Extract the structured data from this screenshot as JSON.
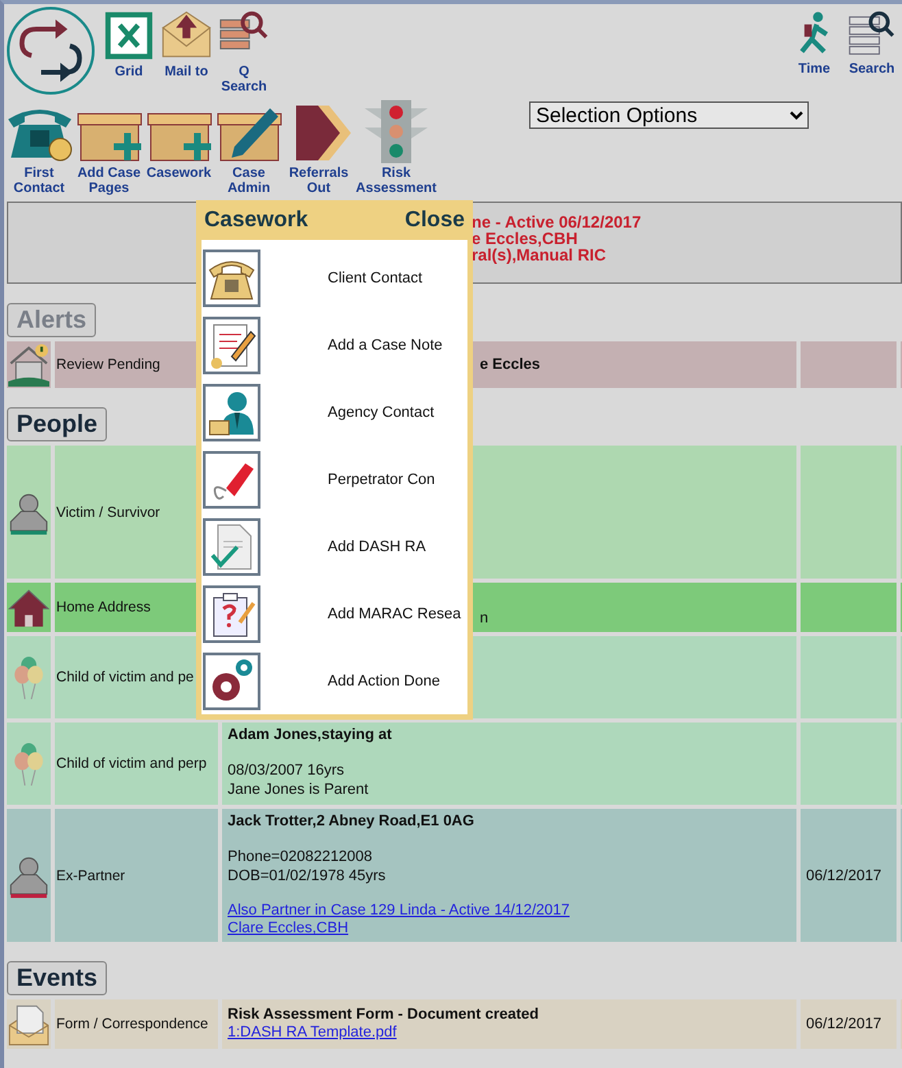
{
  "toolbar_top": [
    {
      "label": "Grid",
      "kind": "grid"
    },
    {
      "label": "Mail to",
      "kind": "mail"
    },
    {
      "label": "Q Search",
      "kind": "qsearch"
    }
  ],
  "toolbar_right": [
    {
      "label": "Time",
      "kind": "time"
    },
    {
      "label": "Search",
      "kind": "search"
    }
  ],
  "toolbar_main": [
    {
      "label": "First Contact",
      "kind": "phone"
    },
    {
      "label": "Add Case Pages",
      "kind": "box-add"
    },
    {
      "label": "Casework",
      "kind": "box-add"
    },
    {
      "label": "Case Admin",
      "kind": "box-edit"
    },
    {
      "label": "Referrals Out",
      "kind": "arrow"
    },
    {
      "label": "Risk Assessment",
      "kind": "traffic"
    }
  ],
  "selection": {
    "value": "Selection Options"
  },
  "case_summary": [
    "ne - Active 06/12/2017",
    "e Eccles,CBH",
    "ral(s),Manual RIC"
  ],
  "sections": [
    {
      "title": "Alerts",
      "disabled": true,
      "rows": [
        {
          "kind": "alert",
          "label": "Review Pending",
          "color": "#c4b0b2",
          "partly_hidden": true,
          "blocks": [
            [
              {
                "kind": "bold",
                "text": "e Eccles"
              }
            ]
          ]
        }
      ]
    },
    {
      "title": "People",
      "disabled": false,
      "rows": [
        {
          "kind": "victim",
          "label": "Victim / Survivor",
          "color": "#aed8b0",
          "partly_hidden": true,
          "blocks": []
        },
        {
          "kind": "house",
          "label": "Home Address",
          "color": "#7dca7a",
          "partly_hidden": true,
          "blocks": [
            [
              {
                "kind": "plain",
                "text": "n"
              }
            ]
          ]
        },
        {
          "kind": "child",
          "label": "Child of victim and pe",
          "color": "#aed8bb",
          "partly_hidden": true,
          "blocks": []
        },
        {
          "kind": "child",
          "label": "Child of victim and perp",
          "color": "#aed8bb",
          "partly_hidden": false,
          "blocks": [
            [
              {
                "kind": "bold",
                "text": "Adam Jones,staying at"
              }
            ],
            [
              {
                "kind": "plain",
                "text": "08/03/2007 16yrs"
              },
              {
                "kind": "plain",
                "text": "Jane Jones is Parent"
              }
            ]
          ]
        },
        {
          "kind": "partner",
          "label": "Ex-Partner",
          "color": "#a5c4c0",
          "partly_hidden": false,
          "date": "06/12/2017",
          "blocks": [
            [
              {
                "kind": "bold",
                "text": "Jack Trotter,2 Abney Road,E1 0AG"
              }
            ],
            [
              {
                "kind": "plain",
                "text": "Phone=02082212008"
              },
              {
                "kind": "plain",
                "text": "DOB=01/02/1978 45yrs"
              }
            ],
            [
              {
                "kind": "link",
                "text": "Also Partner in Case 129 Linda - Active 14/12/2017"
              },
              {
                "kind": "link",
                "text": "Clare Eccles,CBH"
              }
            ]
          ]
        }
      ]
    },
    {
      "title": "Events",
      "disabled": false,
      "rows": [
        {
          "kind": "letter",
          "label": "Form / Correspondence",
          "color": "#d9d2c2",
          "partly_hidden": false,
          "date": "06/12/2017",
          "blocks": [
            [
              {
                "kind": "bold",
                "text": "Risk Assessment Form - Document created"
              },
              {
                "kind": "link",
                "text": "1:DASH RA Template.pdf"
              }
            ]
          ]
        }
      ]
    }
  ],
  "popup": {
    "title": "Casework",
    "close": "Close",
    "items": [
      {
        "label": "Client Contact",
        "kind": "phone"
      },
      {
        "label": "Add a Case Note",
        "kind": "note"
      },
      {
        "label": "Agency Contact",
        "kind": "agent"
      },
      {
        "label": "Perpetrator Con",
        "kind": "redphone"
      },
      {
        "label": "Add DASH RA",
        "kind": "doc-check"
      },
      {
        "label": "Add MARAC Resea",
        "kind": "clipboard"
      },
      {
        "label": "Add Action Done",
        "kind": "gears"
      }
    ]
  }
}
